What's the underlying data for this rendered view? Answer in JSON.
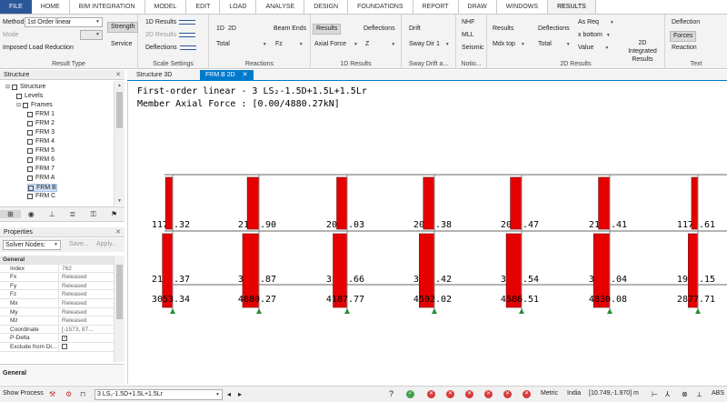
{
  "tabs": [
    "FILE",
    "HOME",
    "BIM INTEGRATION",
    "MODEL",
    "EDIT",
    "LOAD",
    "ANALYSE",
    "DESIGN",
    "FOUNDATIONS",
    "REPORT",
    "DRAW",
    "WINDOWS",
    "RESULTS"
  ],
  "ribbon": {
    "result_type": {
      "method_label": "Method",
      "method_value": "1st Order linear",
      "mode_label": "Mode",
      "imposed": "Imposed Load Reduction",
      "strength": "Strength",
      "service": "Service",
      "title": "Result Type"
    },
    "scale": {
      "r1d": "1D Results",
      "r2d": "2D Results",
      "defl": "Deflections",
      "title": "Scale Settings"
    },
    "reactions": {
      "d1": "1D",
      "d2": "2D",
      "total": "Total",
      "title": "Reactions"
    },
    "beam_ends": {
      "label": "Beam Ends",
      "value": "Fz"
    },
    "results1d": {
      "results": "Results",
      "axial": "Axial Force",
      "deflections": "Deflections",
      "z": "Z",
      "title": "1D Results"
    },
    "drift": {
      "drift": "Drift",
      "sway": "Sway Dir 1",
      "title": "Sway Drift a..."
    },
    "notional": {
      "nhf": "NHF",
      "mll": "MLL",
      "seismic": "Seismic",
      "title": "Notio..."
    },
    "results2d": {
      "results": "Results",
      "mdx": "Mdx top",
      "deflections": "Deflections",
      "total": "Total",
      "asreq": "As Req",
      "xbottom": "x bottom",
      "value": "Value",
      "integrated": "2D Integrated Results",
      "title": "2D Results"
    },
    "text": {
      "deflection": "Deflection",
      "forces": "Forces",
      "reaction": "Reaction",
      "title": "Text"
    }
  },
  "structure_panel": {
    "title": "Structure",
    "tree": [
      {
        "label": "Structure",
        "depth": 0,
        "expanded": true,
        "selected": false
      },
      {
        "label": "Levels",
        "depth": 1,
        "expanded": false,
        "selected": false
      },
      {
        "label": "Frames",
        "depth": 1,
        "expanded": true,
        "selected": false
      },
      {
        "label": "FRM 1",
        "depth": 2,
        "expanded": false,
        "selected": false
      },
      {
        "label": "FRM 2",
        "depth": 2,
        "expanded": false,
        "selected": false
      },
      {
        "label": "FRM 3",
        "depth": 2,
        "expanded": false,
        "selected": false
      },
      {
        "label": "FRM 4",
        "depth": 2,
        "expanded": false,
        "selected": false
      },
      {
        "label": "FRM 5",
        "depth": 2,
        "expanded": false,
        "selected": false
      },
      {
        "label": "FRM 6",
        "depth": 2,
        "expanded": false,
        "selected": false
      },
      {
        "label": "FRM 7",
        "depth": 2,
        "expanded": false,
        "selected": false
      },
      {
        "label": "FRM A",
        "depth": 2,
        "expanded": false,
        "selected": false
      },
      {
        "label": "FRM B",
        "depth": 2,
        "expanded": false,
        "selected": true
      },
      {
        "label": "FRM C",
        "depth": 2,
        "expanded": false,
        "selected": false
      }
    ]
  },
  "properties_panel": {
    "title": "Properties",
    "select_value": "Solver Nodes:",
    "save": "Save...",
    "apply": "Apply...",
    "section": "General",
    "rows": [
      {
        "key": "Index",
        "value": "762"
      },
      {
        "key": "Fx",
        "value": "Released"
      },
      {
        "key": "Fy",
        "value": "Released"
      },
      {
        "key": "Fz",
        "value": "Released"
      },
      {
        "key": "Mx",
        "value": "Released"
      },
      {
        "key": "My",
        "value": "Released"
      },
      {
        "key": "Mz",
        "value": "Released"
      },
      {
        "key": "Coordinate",
        "value": "[-1573, 87..."
      },
      {
        "key": "P-Delta",
        "value": ""
      },
      {
        "key": "Exclude from Di...",
        "value": ""
      }
    ],
    "footer": "General"
  },
  "doc_tabs": [
    {
      "label": "Structure 3D",
      "active": false
    },
    {
      "label": "FRM B 2D",
      "active": true
    }
  ],
  "canvas": {
    "title1": "First-order linear - 3 LS₂-1.5D+1.5L+1.5Lr",
    "title2": "Member Axial Force : [0.00/4880.27kN]",
    "axial_max": 4880.27,
    "rows": [
      [
        "1174.32",
        "2110.90",
        "2066.03",
        "2053.38",
        "2059.47",
        "2114.41",
        "1179.61"
      ],
      [
        "2123.37",
        "3492.87",
        "3101.66",
        "3291.42",
        "3350.54",
        "3364.04",
        "1904.15"
      ],
      [
        "3053.34",
        "4880.27",
        "4187.77",
        "4502.02",
        "4586.51",
        "4830.08",
        "2877.71"
      ]
    ]
  },
  "statusbar": {
    "show_process": "Show Process",
    "combo": "3 LS₂-1.5D+1.5L+1.5Lr",
    "metric": "Metric",
    "country": "India",
    "coords": "[10.749,-1.970] m",
    "abs": "ABS"
  }
}
